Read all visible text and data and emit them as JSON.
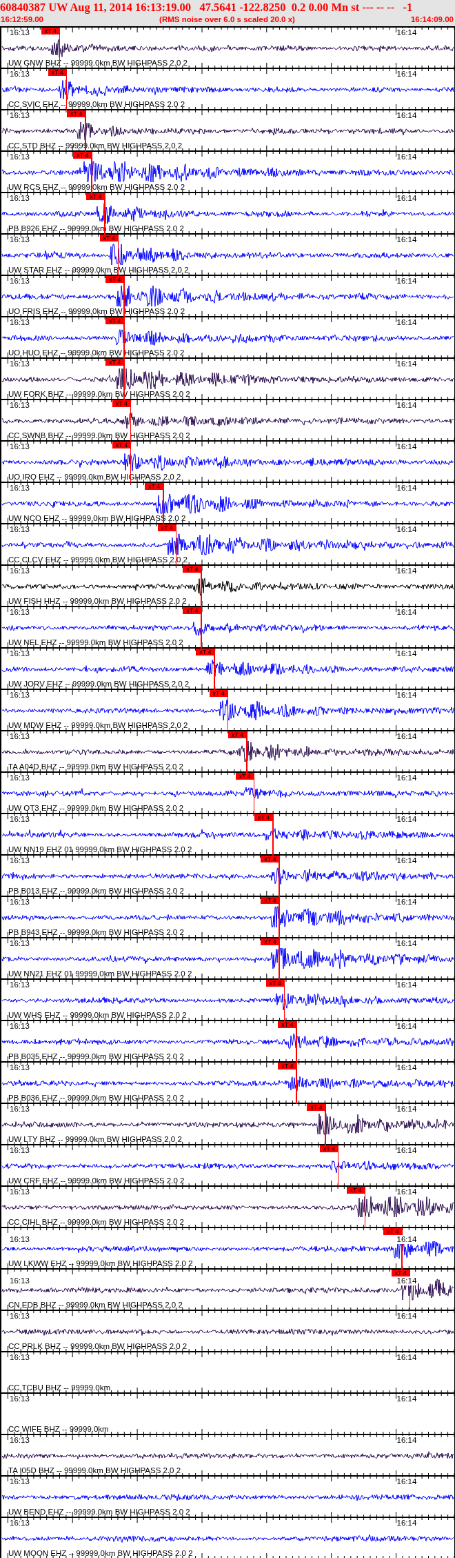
{
  "header": {
    "title": "60840387 UW Aug 11, 2014 16:13:19.00   47.5641 -122.8250  0.2 0.00 Mn st --- -- --   -1",
    "start_time": "16:12:59.00",
    "note": "(RMS noise over 6.0 s scaled 20.0 x)",
    "end_time": "16:14:09.00"
  },
  "traces": [
    {
      "label": "UW GNW BHZ -- 99999.0km BW HIGHPASS 2.0 2",
      "kind": "waveform",
      "color": "#2a0c4e",
      "start_label": "16:13",
      "end_label": "16:14",
      "pick": {
        "label": "xT 4",
        "level": 0.129
      }
    },
    {
      "label": "CC SVIC EHZ -- 99999.0km BW HIGHPASS 2.0 2",
      "kind": "waveform",
      "color": "#0000ff",
      "start_label": "16:13",
      "end_label": "16:14",
      "pick": {
        "label": "xT 4",
        "level": 0.144
      }
    },
    {
      "label": "CC STD BHZ -- 99999.0km BW HIGHPASS 2.0 2",
      "kind": "waveform",
      "color": "#2a0c4e",
      "start_label": "16:13",
      "end_label": "16:14",
      "pick": {
        "label": "xT 4",
        "level": 0.186
      }
    },
    {
      "label": "UW RCS EHZ -- 99999.0km BW HIGHPASS 2.0 2",
      "kind": "waveform",
      "color": "#0000ff",
      "start_label": "16:13",
      "end_label": "16:14",
      "pick": {
        "label": "xT 4",
        "level": 0.2
      }
    },
    {
      "label": "PB B926 EHZ -- 99999.0km BW HIGHPASS 2.0 2",
      "kind": "waveform",
      "color": "#0000ff",
      "start_label": "16:13",
      "end_label": "16:14",
      "pick": {
        "label": "xT 4",
        "level": 0.229
      }
    },
    {
      "label": "UW STAR EHZ -- 99999.0km BW HIGHPASS 2.0 2",
      "kind": "waveform",
      "color": "#0000ff",
      "start_label": "16:13",
      "end_label": "16:14",
      "pick": {
        "label": "xT 4",
        "level": 0.258
      }
    },
    {
      "label": "UO FRIS EHZ -- 99999.0km BW HIGHPASS 2.0 2",
      "kind": "waveform",
      "color": "#0000ff",
      "start_label": "16:13",
      "end_label": "16:14",
      "pick": {
        "label": "xT 4",
        "level": 0.271
      }
    },
    {
      "label": "UO HUO EHZ -- 99999.0km BW HIGHPASS 2.0 2",
      "kind": "waveform",
      "color": "#0000ff",
      "start_label": "16:13",
      "end_label": "16:14",
      "pick": {
        "label": "xT 4",
        "level": 0.271
      }
    },
    {
      "label": "UW FORK BHZ -- 99999.0km BW HIGHPASS 2.0 2",
      "kind": "waveform",
      "color": "#2a0c4e",
      "start_label": "16:13",
      "end_label": "16:14",
      "pick": {
        "label": "xT 4",
        "level": 0.271
      }
    },
    {
      "label": "CC SWNB BHZ -- 99999.0km BW HIGHPASS 2.0 2",
      "kind": "waveform",
      "color": "#2a0c4e",
      "start_label": "16:13",
      "end_label": "16:14",
      "pick": {
        "label": "xT 4",
        "level": 0.286
      }
    },
    {
      "label": "UO IRO EHZ -- 99999.0km BW HIGHPASS 2.0 2",
      "kind": "waveform",
      "color": "#0000ff",
      "start_label": "16:13",
      "end_label": "16:14",
      "pick": {
        "label": "xT 4",
        "level": 0.286
      }
    },
    {
      "label": "UW NCO EHZ -- 99999.0km BW HIGHPASS 2.0 2",
      "kind": "waveform",
      "color": "#0000ff",
      "start_label": "16:13",
      "end_label": "16:14",
      "pick": {
        "label": "xT 4",
        "level": 0.358
      }
    },
    {
      "label": "CC CLCV EHZ -- 99999.0km BW HIGHPASS 2.0 2",
      "kind": "waveform",
      "color": "#0000ff",
      "start_label": "16:13",
      "end_label": "16:14",
      "pick": {
        "label": "xT 4",
        "level": 0.386
      }
    },
    {
      "label": "UW FISH HHZ -- 99999.0km BW HIGHPASS 2.0 2",
      "kind": "waveform",
      "color": "#000000",
      "start_label": "16:13",
      "end_label": "16:14",
      "pick": {
        "label": "xT 4",
        "level": 0.442
      }
    },
    {
      "label": "UW NEL EHZ -- 99999.0km BW HIGHPASS 2.0 2",
      "kind": "waveform",
      "color": "#0000ff",
      "start_label": "16:13",
      "end_label": "16:14",
      "pick": {
        "label": "xT 4",
        "level": 0.442
      }
    },
    {
      "label": "UW JORV EHZ -- 99999.0km BW HIGHPASS 2.0 2",
      "kind": "waveform",
      "color": "#0000ff",
      "start_label": "16:13",
      "end_label": "16:14",
      "pick": {
        "label": "xT 4",
        "level": 0.471
      }
    },
    {
      "label": "UW MDW EHZ -- 99999.0km BW HIGHPASS 2.0 2",
      "kind": "waveform",
      "color": "#0000ff",
      "start_label": "16:13",
      "end_label": "16:14",
      "pick": {
        "label": "xT 4",
        "level": 0.5
      }
    },
    {
      "label": "TA A04D BHZ -- 99999.0km BW HIGHPASS 2.0 2",
      "kind": "waveform",
      "color": "#2a0c4e",
      "start_label": "16:13",
      "end_label": "16:14",
      "pick": {
        "label": "xT 4",
        "level": 0.542
      }
    },
    {
      "label": "UW OT3 EHZ -- 99999.0km BW HIGHPASS 2.0 2",
      "kind": "waveform",
      "color": "#0000ff",
      "start_label": "16:13",
      "end_label": "16:14",
      "pick": {
        "label": "xT 4",
        "level": 0.558
      }
    },
    {
      "label": "UW NN19 EHZ 01 99999.0km BW HIGHPASS 2.0 2",
      "kind": "waveform",
      "color": "#0000ff",
      "start_label": "16:13",
      "end_label": "16:14",
      "pick": {
        "label": "xT 4",
        "level": 0.6
      }
    },
    {
      "label": "PB B013 EHZ -- 99999.0km BW HIGHPASS 2.0 2",
      "kind": "waveform",
      "color": "#0000ff",
      "start_label": "16:13",
      "end_label": "16:14",
      "pick": {
        "label": "xT 4",
        "level": 0.614
      }
    },
    {
      "label": "PB B943 EHZ -- 99999.0km BW HIGHPASS 2.0 2",
      "kind": "waveform",
      "color": "#0000ff",
      "start_label": "16:13",
      "end_label": "16:14",
      "pick": {
        "label": "xT 4",
        "level": 0.614
      }
    },
    {
      "label": "UW NN21 EHZ 01 99999.0km BW HIGHPASS 2.0 2",
      "kind": "waveform",
      "color": "#0000ff",
      "start_label": "16:13",
      "end_label": "16:14",
      "pick": {
        "label": "xT 4",
        "level": 0.614
      }
    },
    {
      "label": "UW WHS EHZ -- 99999.0km BW HIGHPASS 2.0 2",
      "kind": "waveform",
      "color": "#0000ff",
      "start_label": "16:13",
      "end_label": "16:14",
      "pick": {
        "label": "xT 4",
        "level": 0.625
      }
    },
    {
      "label": "PB B035 EHZ -- 99999.0km BW HIGHPASS 2.0 2",
      "kind": "waveform",
      "color": "#0000ff",
      "start_label": "16:13",
      "end_label": "16:14",
      "pick": {
        "label": "xT 4",
        "level": 0.652
      }
    },
    {
      "label": "PB B036 EHZ -- 99999.0km BW HIGHPASS 2.0 2",
      "kind": "waveform",
      "color": "#0000ff",
      "start_label": "16:13",
      "end_label": "16:14",
      "pick": {
        "label": "xT 4",
        "level": 0.652
      }
    },
    {
      "label": "UW LTY BHZ -- 99999.0km BW HIGHPASS 2.0 2",
      "kind": "waveform",
      "color": "#2a0c4e",
      "start_label": "16:13",
      "end_label": "16:14",
      "pick": {
        "label": "xT 4",
        "level": 0.716
      }
    },
    {
      "label": "UW CRF EHZ -- 99999.0km BW HIGHPASS 2.0 2",
      "kind": "waveform",
      "color": "#0000ff",
      "start_label": "16:13",
      "end_label": "16:14",
      "pick": {
        "label": "xT 4",
        "level": 0.744
      }
    },
    {
      "label": "CC CIHL BHZ -- 99999.0km BW HIGHPASS 2.0 2",
      "kind": "waveform",
      "color": "#2a0c4e",
      "start_label": "16:13",
      "end_label": "16:14",
      "pick": {
        "label": "xT 4",
        "level": 0.803
      }
    },
    {
      "label": "UW LKWW EHZ -- 99999.0km BW HIGHPASS 2.0 2",
      "kind": "waveform",
      "color": "#0000ff",
      "start_label": "16:13",
      "end_label": "16:14",
      "pick": {
        "label": "xT 4",
        "level": 0.885
      }
    },
    {
      "label": "CN EDB BHZ -- 99999.0km BW HIGHPASS 2.0 2",
      "kind": "waveform",
      "color": "#2a0c4e",
      "start_label": "16:13",
      "end_label": "16:14",
      "pick": {
        "label": "xT 4",
        "level": 0.902
      }
    },
    {
      "label": "CC PRLK BHZ -- 99999.0km BW HIGHPASS 2.0 2",
      "kind": "waveform",
      "color": "#2a0c4e",
      "start_label": "16:13",
      "end_label": "16:14"
    },
    {
      "label": "CC TCBU BHZ -- 99999.0km",
      "kind": "flat",
      "start_label": "16:13",
      "end_label": "16:14"
    },
    {
      "label": "CC WIFE BHZ -- 99999.0km",
      "kind": "flat",
      "start_label": "16:13",
      "end_label": "16:14"
    },
    {
      "label": "TA I05D BHZ -- 99999.0km BW HIGHPASS 2.0 2",
      "kind": "waveform",
      "color": "#2a0c4e",
      "start_label": "16:13",
      "end_label": "16:14"
    },
    {
      "label": "UW BEND EHZ -- 99999.0km BW HIGHPASS 2.0 2",
      "kind": "waveform",
      "color": "#0000ff",
      "start_label": "16:13",
      "end_label": "16:14"
    },
    {
      "label": "UW MOON EHZ -- 99999.0km BW HIGHPASS 2.0 2",
      "kind": "waveform",
      "color": "#0000ff",
      "start_label": "16:13",
      "end_label": "16:14"
    }
  ]
}
